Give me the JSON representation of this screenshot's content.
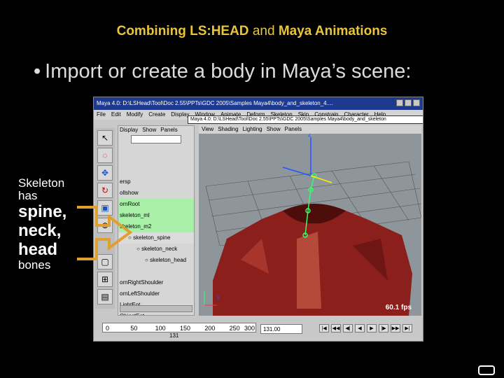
{
  "slide": {
    "title_part1": "Combining LS:HEAD",
    "title_mid": " and ",
    "title_part2": "Maya Animations",
    "bullet": "Import or create a body in Maya’s scene:",
    "bullet_marker": "•"
  },
  "maya": {
    "window_title": "Maya 4.0: D:\\LSHead\\Tool\\Doc 2.55\\PPTs\\GDC 2005\\Samples Maya4\\body_and_skeleton_4....",
    "menus": [
      "File",
      "Edit",
      "Modify",
      "Create",
      "Display",
      "Window",
      "Animate",
      "Deform",
      "Skeleton",
      "Skin",
      "Constrain",
      "Character",
      "Help"
    ],
    "panel_title": "Maya 4.0: D:\\LSHead\\Tool\\Doc 2.55\\PPTs\\GDC 2005\\Samples Maya4\\body_and_skeleton",
    "outliner": {
      "menus": [
        "Display",
        "Show",
        "Panels"
      ],
      "rows": [
        {
          "label": "ersp",
          "state": "normal",
          "indent": 0
        },
        {
          "label": "ollshow",
          "state": "normal",
          "indent": 0
        },
        {
          "label": "ornRoot",
          "state": "selected",
          "indent": 0
        },
        {
          "label": "skeleton_ml",
          "state": "selected",
          "indent": 0
        },
        {
          "label": "skeleton_m2",
          "state": "selected",
          "indent": 0
        },
        {
          "label": "skeleton_spine",
          "state": "subselected",
          "indent": 1
        },
        {
          "label": "skeleton_neck",
          "state": "normal",
          "indent": 2
        },
        {
          "label": "skeleton_head",
          "state": "normal",
          "indent": 3
        },
        {
          "label": "",
          "state": "normal",
          "indent": 0
        },
        {
          "label": "ornRightShoulder",
          "state": "normal",
          "indent": 0
        },
        {
          "label": "ornLeftShoulder",
          "state": "normal",
          "indent": 0
        },
        {
          "label": "LightEot",
          "state": "normal",
          "indent": 0
        },
        {
          "label": "ObjectEot",
          "state": "normal",
          "indent": 0
        }
      ]
    },
    "viewport": {
      "menus": [
        "View",
        "Shading",
        "Lighting",
        "Show",
        "Panels"
      ],
      "fps": "60.1 fps",
      "axis_z": "z",
      "axis_y": "y"
    },
    "timeline": {
      "ticks": [
        "0",
        "50",
        "100",
        "150",
        "200",
        "250",
        "300"
      ],
      "current_frame": "131",
      "time_field": "131.00",
      "play_buttons": [
        "|◀",
        "◀◀",
        "◀|",
        "◀",
        "▶",
        "|▶",
        "▶▶",
        "▶|"
      ]
    }
  },
  "callout": {
    "line1": "Skeleton",
    "line2": "has",
    "line3": "spine,",
    "line4": "neck,",
    "line5": "head",
    "line6": "bones"
  },
  "colors": {
    "title": "#e8c53a",
    "selection": "#a8f0a8",
    "arrow": "#e0a030",
    "jacket": "#8a1f1c"
  }
}
